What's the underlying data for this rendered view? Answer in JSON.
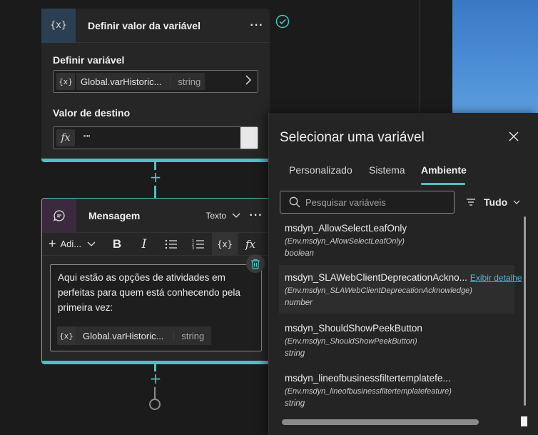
{
  "card_set": {
    "icon": "{x}",
    "title": "Definir valor da variável",
    "more": "···",
    "define_label": "Definir variável",
    "variable_icon": "{x}",
    "variable_name": "Global.varHistoric...",
    "variable_type": "string",
    "target_label": "Valor de destino",
    "fx_icon": "fx",
    "target_value": "\"\""
  },
  "card_message": {
    "title": "Mensagem",
    "type_label": "Texto",
    "more": "···",
    "toolbar": {
      "add_label": "Adi...",
      "bold": "B",
      "italic": "I",
      "var_icon": "{x}",
      "fx_icon": "fx"
    },
    "body_text": "Aqui estão as opções de atividades em perfeitas para quem está conhecendo pela primeira vez:",
    "variable_icon": "{x}",
    "variable_name": "Global.varHistoric...",
    "variable_type": "string"
  },
  "panel": {
    "title": "Selecionar uma variável",
    "tabs": [
      {
        "label": "Personalizado"
      },
      {
        "label": "Sistema"
      },
      {
        "label": "Ambiente"
      }
    ],
    "active_tab": "Ambiente",
    "search_placeholder": "Pesquisar variáveis",
    "filter_label": "Tudo",
    "variables": [
      {
        "name": "msdyn_AllowSelectLeafOnly",
        "path": "(Env.msdyn_AllowSelectLeafOnly)",
        "type": "boolean"
      },
      {
        "name": "msdyn_SLAWebClientDeprecationAckno...",
        "path": "(Env.msdyn_SLAWebClientDeprecationAcknowledge)",
        "type": "number",
        "link": "Exibir detalhe"
      },
      {
        "name": "msdyn_ShouldShowPeekButton",
        "path": "(Env.msdyn_ShouldShowPeekButton)",
        "type": "string"
      },
      {
        "name": "msdyn_lineofbusinessfiltertemplatefe...",
        "path": "(Env.msdyn_lineofbusinessfiltertemplatefeature)",
        "type": "string"
      }
    ]
  },
  "colors": {
    "accent": "#4fc0c4",
    "background": "#1b1b1b",
    "card": "#262626",
    "panel": "#242424",
    "link": "#4fb6d9",
    "message_icon_bg": "#3b2a3e"
  },
  "icons": [
    "variable-icon",
    "more-icon",
    "chevron-right-icon",
    "fx-icon",
    "plus-icon",
    "check-circle-icon",
    "message-icon",
    "chevron-down-icon",
    "bold-icon",
    "italic-icon",
    "bullet-list-icon",
    "numbered-list-icon",
    "trash-icon",
    "close-icon",
    "search-icon",
    "filter-icon"
  ]
}
